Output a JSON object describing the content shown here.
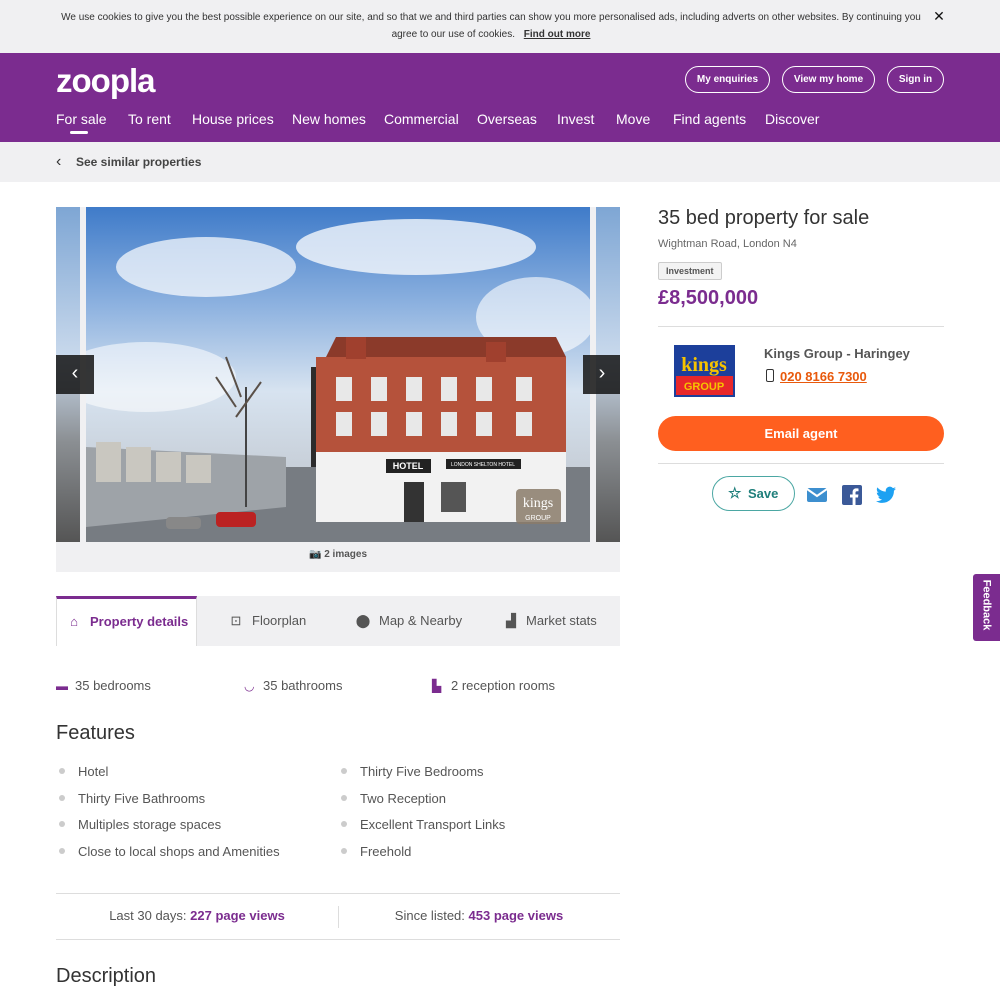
{
  "cookie": {
    "text": "We use cookies to give you the best possible experience on our site, and so that we and third parties can show you more personalised ads, including adverts on other websites. By continuing you agree to our use of cookies.",
    "link": "Find out more"
  },
  "header": {
    "logo": "zoopla",
    "buttons": {
      "enquiries": "My enquiries",
      "view_home": "View my home",
      "sign_in": "Sign in"
    },
    "nav": [
      "For sale",
      "To rent",
      "House prices",
      "New homes",
      "Commercial",
      "Overseas",
      "Invest",
      "Move",
      "Find agents",
      "Discover"
    ]
  },
  "similar": {
    "label": "See similar properties"
  },
  "gallery": {
    "count": "2 images",
    "sign_text": "HOTEL",
    "hotel_sign": "LONDON SHELTON HOTEL",
    "watermark": "kings GROUP"
  },
  "listing": {
    "title": "35 bed property for sale",
    "address": "Wightman Road, London N4",
    "tag": "Investment",
    "price": "£8,500,000"
  },
  "agent": {
    "name": "Kings Group - Haringey",
    "phone": "020 8166 7300",
    "logo_top": "kings",
    "logo_bottom": "GROUP",
    "email_button": "Email agent",
    "save_button": "Save"
  },
  "tabs": [
    "Property details",
    "Floorplan",
    "Map & Nearby",
    "Market stats"
  ],
  "attributes": {
    "bedrooms": "35 bedrooms",
    "bathrooms": "35 bathrooms",
    "reception": "2 reception rooms"
  },
  "features": {
    "heading": "Features",
    "left": [
      "Hotel",
      "Thirty Five Bathrooms",
      "Multiples storage spaces",
      "Close to local shops and Amenities"
    ],
    "right": [
      "Thirty Five Bedrooms",
      "Two Reception",
      "Excellent Transport Links",
      "Freehold"
    ]
  },
  "views": {
    "last_label": "Last 30 days:",
    "last_value": "227 page views",
    "since_label": "Since listed:",
    "since_value": "453 page views"
  },
  "description": {
    "heading": "Description"
  },
  "feedback": "Feedback",
  "colors": {
    "brand": "#7b2c8f",
    "accent": "#ff5f1f",
    "teal": "#1f7f7b"
  }
}
